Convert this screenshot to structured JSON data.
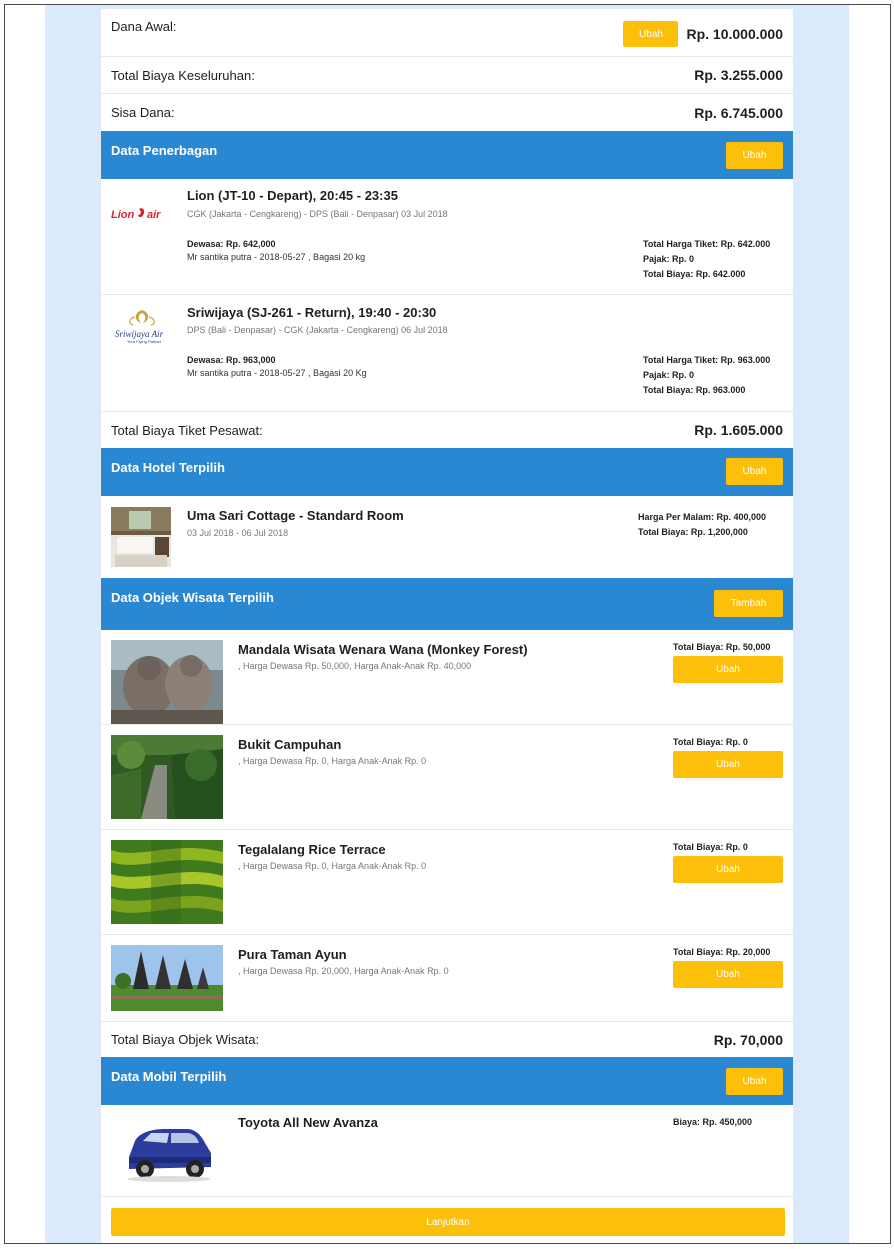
{
  "summary": {
    "dana_awal_label": "Dana Awal:",
    "dana_awal_button": "Ubah",
    "dana_awal_value": "Rp. 10.000.000",
    "total_label": "Total Biaya Keseluruhan:",
    "total_value": "Rp. 3.255.000",
    "sisa_label": "Sisa Dana:",
    "sisa_value": "Rp. 6.745.000"
  },
  "flights": {
    "header": "Data Penerbagan",
    "button": "Ubah",
    "items": [
      {
        "logo_text": "Lion air",
        "title": "Lion (JT-10 - Depart), 20:45 - 23:35",
        "route": "CGK (Jakarta - Cengkareng) - DPS (Bali - Denpasar)  03 Jul 2018",
        "adult": "Dewasa: Rp. 642,000",
        "passenger": "Mr santika putra - 2018-05-27 , Bagasi 20 kg",
        "ticket_total": "Total Harga Tiket: Rp. 642.000",
        "tax": "Pajak: Rp. 0",
        "total": "Total Biaya: Rp. 642.000"
      },
      {
        "logo_text": "Sriwijaya Air",
        "title": "Sriwijaya (SJ-261 - Return), 19:40 - 20:30",
        "route": "DPS (Bali - Denpasar) - CGK (Jakarta - Cengkareng)  06 Jul 2018",
        "adult": "Dewasa: Rp. 963,000",
        "passenger": "Mr santika putra - 2018-05-27 , Bagasi 20 Kg",
        "ticket_total": "Total Harga Tiket: Rp. 963.000",
        "tax": "Pajak: Rp. 0",
        "total": "Total Biaya: Rp. 963.000"
      }
    ],
    "total_label": "Total Biaya Tiket Pesawat:",
    "total_value": "Rp. 1.605.000"
  },
  "hotel": {
    "header": "Data Hotel Terpilih",
    "button": "Ubah",
    "name": "Uma Sari Cottage - Standard Room",
    "dates": "03 Jul 2018 - 06 Jul 2018",
    "per_night": "Harga Per Malam: Rp. 400,000",
    "total": "Total Biaya: Rp. 1,200,000"
  },
  "attractions": {
    "header": "Data Objek Wisata Terpilih",
    "button": "Tambah",
    "items": [
      {
        "title": "Mandala Wisata Wenara Wana (Monkey Forest)",
        "desc": ", Harga Dewasa Rp. 50,000, Harga Anak-Anak Rp. 40,000",
        "total": "Total Biaya: Rp. 50,000",
        "button": "Ubah"
      },
      {
        "title": "Bukit Campuhan",
        "desc": ", Harga Dewasa Rp. 0, Harga Anak-Anak Rp. 0",
        "total": "Total Biaya: Rp. 0",
        "button": "Ubah"
      },
      {
        "title": "Tegalalang Rice Terrace",
        "desc": ", Harga Dewasa Rp. 0, Harga Anak-Anak Rp. 0",
        "total": "Total Biaya: Rp. 0",
        "button": "Ubah"
      },
      {
        "title": "Pura Taman Ayun",
        "desc": ", Harga Dewasa Rp. 20,000, Harga Anak-Anak Rp. 0",
        "total": "Total Biaya: Rp. 20,000",
        "button": "Ubah"
      }
    ],
    "total_label": "Total Biaya Objek Wisata:",
    "total_value": "Rp. 70,000"
  },
  "car": {
    "header": "Data Mobil Terpilih",
    "button": "Ubah",
    "name": "Toyota All New Avanza",
    "price": "Biaya: Rp. 450,000"
  },
  "continue_button": "Lanjutkan",
  "colors": {
    "header_blue": "#2a88d3",
    "button_yellow": "#fcbf0a",
    "page_bg_blue": "#dbeafc"
  }
}
